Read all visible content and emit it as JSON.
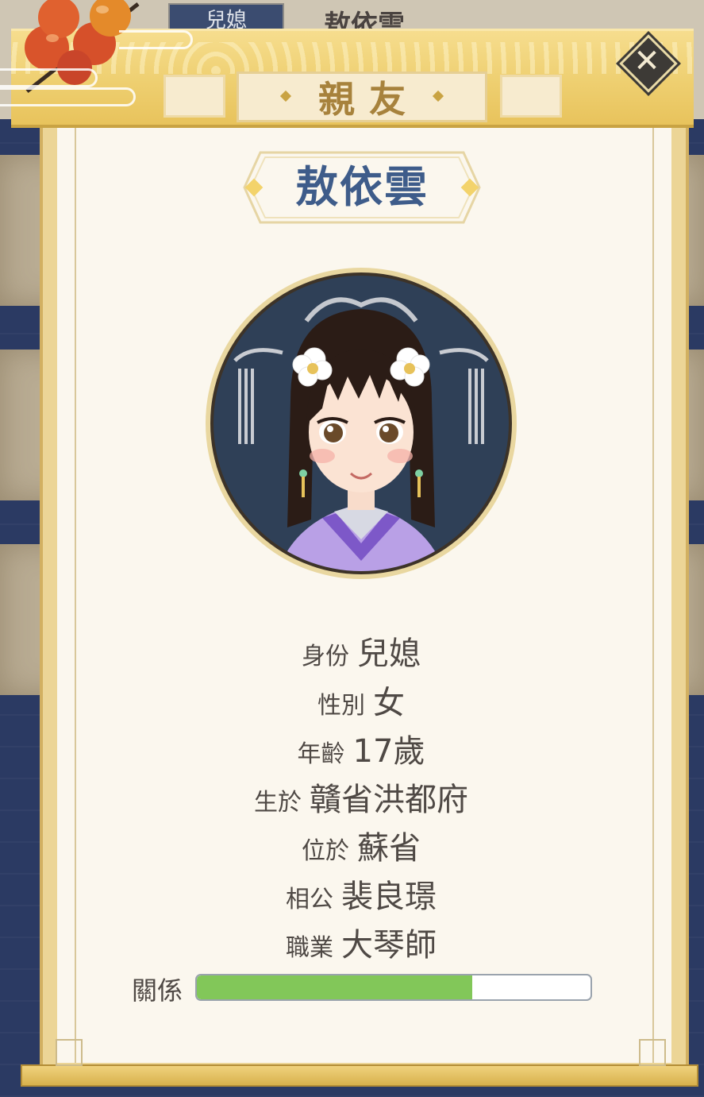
{
  "background": {
    "tab_label": "兒媳",
    "title": "敖依雲"
  },
  "dialog": {
    "header_title": "親友",
    "close_icon": "close-icon"
  },
  "profile": {
    "name": "敖依雲",
    "fields": [
      {
        "label": "身份",
        "value": "兒媳"
      },
      {
        "label": "性別",
        "value": "女"
      },
      {
        "label": "年齡",
        "value": "17歲"
      },
      {
        "label": "生於",
        "value": "贛省洪都府"
      },
      {
        "label": "位於",
        "value": "蘇省"
      },
      {
        "label": "相公",
        "value": "裴良璟"
      },
      {
        "label": "職業",
        "value": "大琴師"
      }
    ],
    "relationship": {
      "label": "關係",
      "percent": 70
    }
  },
  "colors": {
    "name_blue": "#3e5c8a",
    "progress_green": "#82c759",
    "gold": "#e8c35c"
  }
}
